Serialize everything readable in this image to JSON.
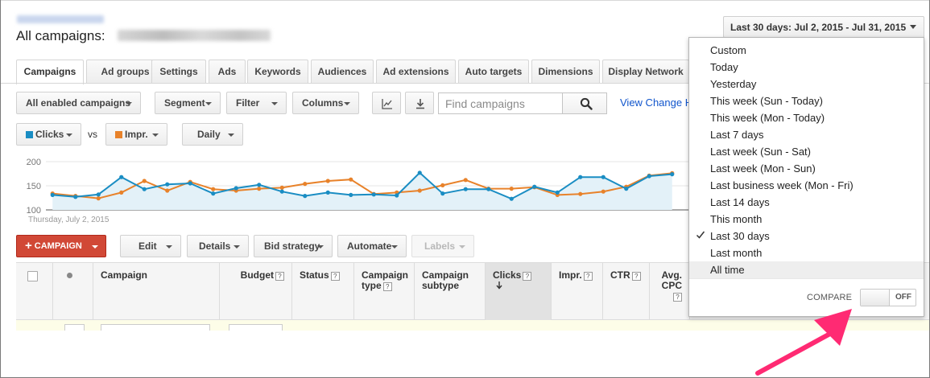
{
  "header": {
    "title": "All campaigns:",
    "date_range": "Last 30 days: Jul 2, 2015 - Jul 31, 2015"
  },
  "tabs": [
    {
      "label": "Campaigns",
      "active": true
    },
    {
      "label": "Ad groups"
    },
    {
      "label": "Settings"
    },
    {
      "label": "Ads"
    },
    {
      "label": "Keywords"
    },
    {
      "label": "Audiences"
    },
    {
      "label": "Ad extensions"
    },
    {
      "label": "Auto targets"
    },
    {
      "label": "Dimensions"
    },
    {
      "label": "Display Network"
    }
  ],
  "toolbar": {
    "filter_campaigns": "All enabled campaigns",
    "segment": "Segment",
    "filter": "Filter",
    "columns": "Columns",
    "search_placeholder": "Find campaigns",
    "view_change_history": "View Change H"
  },
  "chart_controls": {
    "metric1": "Clicks",
    "vs": "vs",
    "metric2": "Impr.",
    "interval": "Daily",
    "metric1_color": "#1a8dc3",
    "metric2_color": "#e8822a"
  },
  "chart_data": {
    "type": "line",
    "x_start_label": "Thursday, July 2, 2015",
    "yticks": [
      "200",
      "150",
      "100"
    ],
    "ylim": [
      100,
      200
    ],
    "grid": true,
    "series": [
      {
        "name": "Clicks",
        "color": "#1a8dc3",
        "values": [
          131,
          127,
          132,
          168,
          143,
          153,
          155,
          134,
          145,
          152,
          138,
          129,
          136,
          131,
          132,
          130,
          177,
          134,
          143,
          143,
          123,
          148,
          136,
          168,
          168,
          144,
          170,
          174
        ]
      },
      {
        "name": "Impr.",
        "color": "#e8822a",
        "values": [
          134,
          129,
          124,
          136,
          160,
          140,
          158,
          143,
          140,
          144,
          146,
          154,
          160,
          163,
          133,
          136,
          140,
          151,
          162,
          144,
          144,
          147,
          131,
          133,
          138,
          148,
          171,
          176
        ]
      }
    ]
  },
  "actions": {
    "new_campaign": "CAMPAIGN",
    "edit": "Edit",
    "details": "Details",
    "bid_strategy": "Bid strategy",
    "automate": "Automate",
    "labels": "Labels"
  },
  "table": {
    "columns": [
      {
        "label": "Campaign"
      },
      {
        "label": "Budget",
        "help": true
      },
      {
        "label": "Status",
        "help": true
      },
      {
        "label": "Campaign type",
        "help": true
      },
      {
        "label": "Campaign subtype"
      },
      {
        "label": "Clicks",
        "help": true,
        "sorted": "desc"
      },
      {
        "label": "Impr.",
        "help": true
      },
      {
        "label": "CTR",
        "help": true
      },
      {
        "label": "Avg. CPC",
        "help": true
      }
    ]
  },
  "date_menu": {
    "items": [
      "Custom",
      "Today",
      "Yesterday",
      "This week (Sun - Today)",
      "This week (Mon - Today)",
      "Last 7 days",
      "Last week (Sun - Sat)",
      "Last week (Mon - Sun)",
      "Last business week (Mon - Fri)",
      "Last 14 days",
      "This month",
      "Last 30 days",
      "Last month",
      "All time"
    ],
    "selected": "Last 30 days",
    "hovered": "All time",
    "compare_label": "COMPARE",
    "toggle_state": "OFF"
  },
  "icons": [
    "chart-icon",
    "download-icon",
    "search-icon",
    "check-icon",
    "help-icon",
    "sort-desc-icon"
  ]
}
